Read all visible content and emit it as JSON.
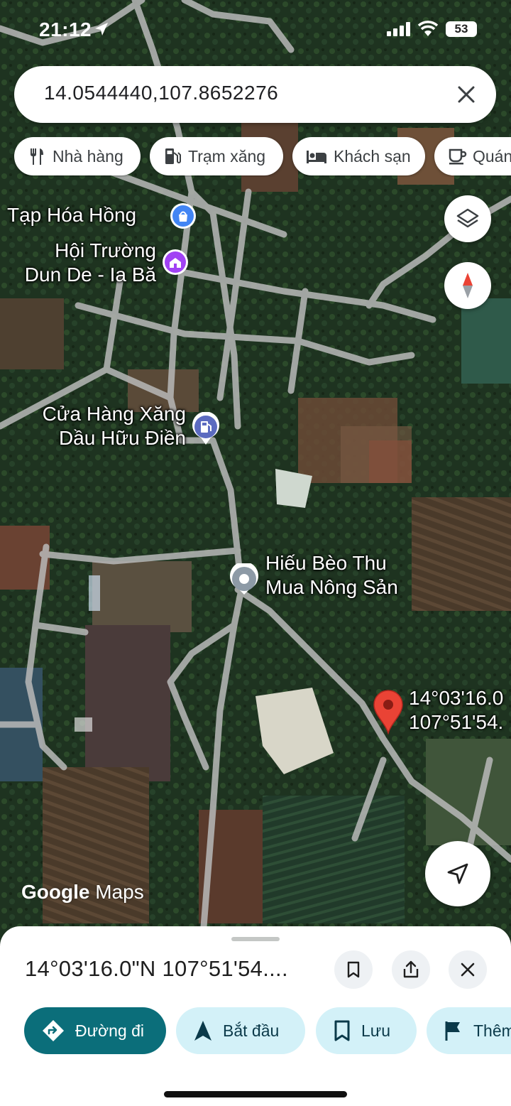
{
  "status_bar": {
    "time": "21:12",
    "battery": "53"
  },
  "search": {
    "query": "14.0544440,107.8652276"
  },
  "chips": [
    {
      "label": "Nhà hàng",
      "icon": "restaurant-icon"
    },
    {
      "label": "Trạm xăng",
      "icon": "gas-station-icon"
    },
    {
      "label": "Khách sạn",
      "icon": "hotel-icon"
    },
    {
      "label": "Quán",
      "icon": "cafe-icon"
    }
  ],
  "map": {
    "pois": [
      {
        "name": "Tạp Hóa Hồng",
        "icon": "shopping-bag-icon",
        "color": "#4285f4"
      },
      {
        "name_line1": "Hội Trường",
        "name_line2": "Dun De - Ia Bă",
        "icon": "landmark-icon",
        "color": "#a142f4"
      },
      {
        "name_line1": "Cửa Hàng Xăng",
        "name_line2": "Dầu Hữu Điền",
        "icon": "gas-station-icon",
        "color": "#5c6bc0"
      },
      {
        "name_line1": "Hiếu Bèo Thu",
        "name_line2": "Mua Nông Sản",
        "icon": "place-icon",
        "color": "#78909c"
      }
    ],
    "dropped_pin": {
      "label_line1": "14°03'16.0",
      "label_line2": "107°51'54.",
      "color": "#ea4335"
    },
    "attribution_google": "Google",
    "attribution_maps": "Maps"
  },
  "sheet": {
    "title": "14°03'16.0\"N 107°51'54....",
    "actions": [
      {
        "label": "Đường đi",
        "icon": "directions-icon",
        "primary": true
      },
      {
        "label": "Bắt đầu",
        "icon": "navigation-icon"
      },
      {
        "label": "Lưu",
        "icon": "bookmark-icon"
      },
      {
        "label": "Thêm",
        "icon": "flag-icon"
      }
    ]
  }
}
